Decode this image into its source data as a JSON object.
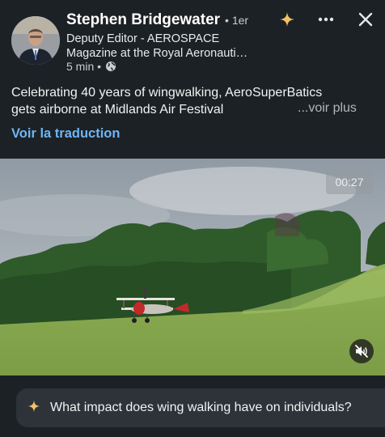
{
  "post": {
    "author": {
      "name": "Stephen Bridgewater",
      "degree": "• 1er",
      "headline": "Deputy Editor - AEROSPACE Magazine at the Royal Aeronauti…",
      "headline_line1": "Deputy Editor - AEROSPACE",
      "headline_line2": "Magazine at the Royal Aeronauti…",
      "time": "5 min •"
    },
    "text_line1": "Celebrating 40 years of wingwalking, AeroSuperBatics",
    "text_line2": "gets airborne at Midlands Air Festival",
    "see_more": "...voir plus",
    "translate": "Voir la traduction"
  },
  "video": {
    "timer": "00:27",
    "muted": true
  },
  "ai_prompt": {
    "text": "What impact does wing walking have on individuals?"
  },
  "icons": {
    "ai": "sparkle-icon",
    "more": "more-icon",
    "close": "close-icon",
    "visibility": "globe-icon",
    "mute": "speaker-muted-icon"
  },
  "colors": {
    "background": "#1c2125",
    "link": "#6fb5f5",
    "sparkle": "#f2c265"
  }
}
